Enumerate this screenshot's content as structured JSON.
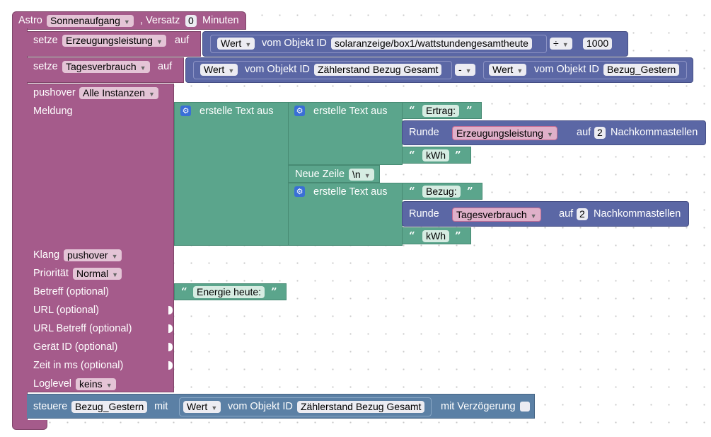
{
  "astro": {
    "label": "Astro",
    "event": "Sonnenaufgang",
    "offset_label": ", Versatz",
    "offset": "0",
    "unit": "Minuten"
  },
  "set1": {
    "label": "setze",
    "var": "Erzeugungsleistung",
    "auf": "auf",
    "wert": "Wert",
    "vom": "vom Objekt ID",
    "id": "solaranzeige/box1/wattstundengesamtheute",
    "op": "÷",
    "num": "1000"
  },
  "set2": {
    "label": "setze",
    "var": "Tagesverbrauch",
    "auf": "auf",
    "wert": "Wert",
    "vom": "vom Objekt ID",
    "id": "Zählerstand Bezug Gesamt",
    "op": "-",
    "wert2": "Wert",
    "vom2": "vom Objekt ID",
    "id2": "Bezug_Gestern"
  },
  "pushover": {
    "label": "pushover",
    "instance": "Alle Instanzen",
    "meldung": "Meldung",
    "klang_label": "Klang",
    "klang": "pushover",
    "prio_label": "Priorität",
    "prio": "Normal",
    "betreff_label": "Betreff (optional)",
    "betreff": "Energie heute:",
    "url_label": "URL (optional)",
    "url_betreff_label": "URL Betreff (optional)",
    "geraet_label": "Gerät ID (optional)",
    "zeit_label": "Zeit in ms (optional)",
    "loglevel_label": "Loglevel",
    "loglevel": "keins"
  },
  "text": {
    "erstelle": "erstelle Text aus",
    "ertrag": "Ertrag:",
    "runde": "Runde",
    "var1": "Erzeugungsleistung",
    "auf": "auf",
    "decimals": "2",
    "nachkomma": "Nachkommastellen",
    "kwh": "kWh",
    "newline_label": "Neue Zeile",
    "newline": "\\n",
    "bezug": "Bezug:",
    "var2": "Tagesverbrauch"
  },
  "steuere": {
    "label": "steuere",
    "target": "Bezug_Gestern",
    "mit": "mit",
    "wert": "Wert",
    "vom": "vom Objekt ID",
    "id": "Zählerstand Bezug Gesamt",
    "delay": "mit Verzögerung"
  },
  "colors": {
    "event": "#a55b8b",
    "text": "#5ba58c",
    "math": "#5b67a5",
    "control": "#5b80a5"
  }
}
